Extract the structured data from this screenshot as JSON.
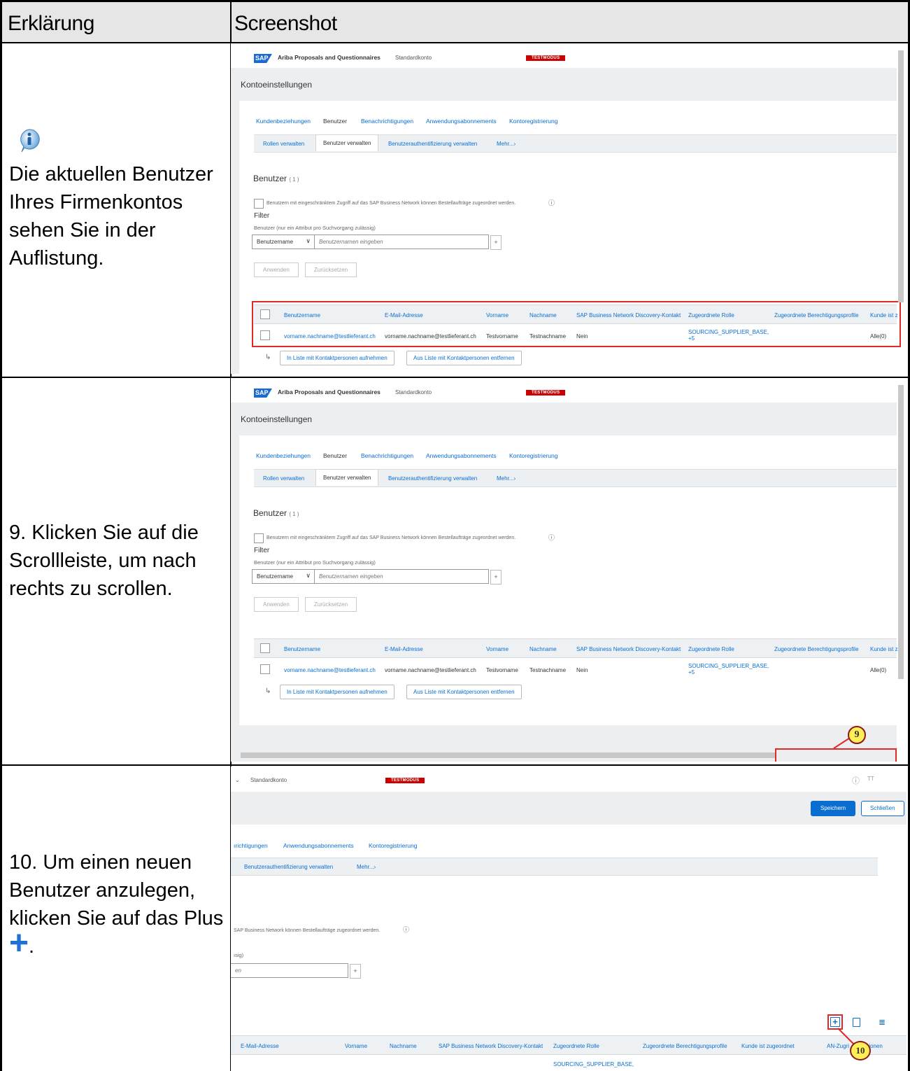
{
  "header": {
    "col1": "Erklärung",
    "col2": "Screenshot"
  },
  "rows": [
    {
      "plain1": "Die ",
      "bold1": "aktuellen Benutzer",
      "plain2": " Ihres Firmenkontos sehen Sie in der Auflistung."
    },
    {
      "plain1": "9. Klicken Sie auf ",
      "bold1": "die Scrollleiste,",
      "plain2": " um nach rechts zu scrollen."
    },
    {
      "plain1": "10. Um einen neuen Benutzer anzulegen, klicken Sie auf ",
      "bold1": "das Plus",
      "plain2": "."
    }
  ],
  "app": {
    "logo": "SAP",
    "title": "Ariba Proposals and Questionnaires",
    "account": "Standardkonto",
    "testmode": "TESTMODUS",
    "page_title": "Kontoeinstellungen",
    "tabs1": [
      "Kundenbeziehungen",
      "Benutzer",
      "Benachrichtigungen",
      "Anwendungsabonnements",
      "Kontoregistrierung"
    ],
    "tabs2": [
      "Rollen verwalten",
      "Benutzer verwalten",
      "Benutzerauthentifizierung verwalten",
      "Mehr...›"
    ],
    "section_title": "Benutzer",
    "section_count": "( 1 )",
    "restrict_text": "Benutzern mit eingeschränktem Zugriff auf das SAP Business Network können Bestellaufträge zugeordnet werden.",
    "filter_label": "Filter",
    "filter_hint": "Benutzer (nur ein Attribut pro Suchvorgang zulässig)",
    "select_value": "Benutzername",
    "input_placeholder": "Benutzernamen eingeben",
    "apply": "Anwenden",
    "reset": "Zurücksetzen",
    "columns": [
      "Benutzername",
      "E-Mail-Adresse",
      "Vorname",
      "Nachname",
      "SAP Business Network Discovery-Kontakt",
      "Zugeordnete Rolle",
      "Zugeordnete Berechtigungsprofile",
      "Kunde ist z"
    ],
    "row": {
      "username": "vorname.nachname@testlieferant.ch",
      "email": "vorname.nachname@testlieferant.ch",
      "first": "Testvorname",
      "last": "Testnachname",
      "discovery": "Nein",
      "role": "SOURCING_SUPPLIER_BASE,",
      "role_more": "+5",
      "customer": "Alle(0)"
    },
    "add_contact": "In Liste mit Kontaktpersonen aufnehmen",
    "remove_contact": "Aus Liste mit Kontaktpersonen entfernen"
  },
  "shot3": {
    "save": "Speichern",
    "close": "Schließen",
    "tabs1_partial": [
      "ırichtigungen",
      "Anwendungsabonnements",
      "Kontoregistrierung"
    ],
    "tabs2_partial": [
      "Benutzerauthentifizierung verwalten",
      "Mehr...›"
    ],
    "restrict_partial": "SAP Business Network können Bestellaufträge zugeordnet werden.",
    "hint_partial": "ısig)",
    "input_partial": "en",
    "columns": [
      "E-Mail-Adresse",
      "Vorname",
      "Nachname",
      "SAP Business Network Discovery-Kontakt",
      "Zugeordnete Rolle",
      "Zugeordnete Berechtigungsprofile",
      "Kunde ist zugeordnet",
      "AN-Zugri",
      "tionen"
    ],
    "row_role": "SOURCING_SUPPLIER_BASE,"
  },
  "callouts": {
    "step9": "9",
    "step10": "10"
  },
  "colors": {
    "red": "#e02a2a",
    "sap_blue": "#0a6ed1",
    "callout_fill": "#ffee55"
  }
}
